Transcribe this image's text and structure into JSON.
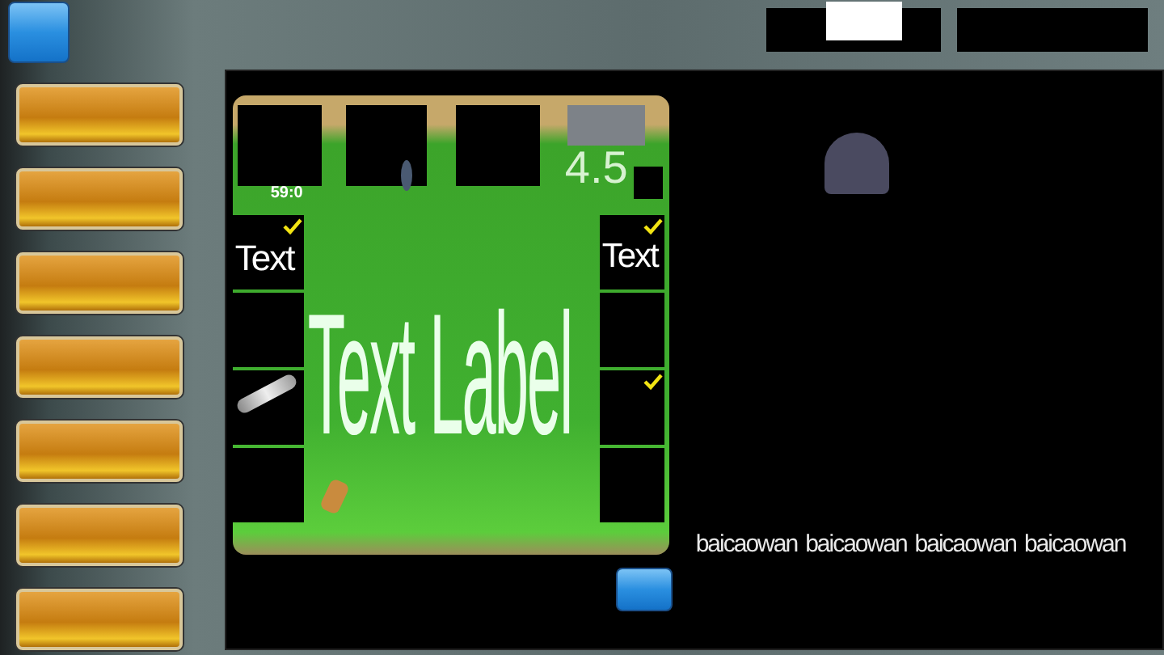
{
  "board": {
    "score": "59:0",
    "odds": "4.5",
    "label": "Text Label",
    "left_slots": [
      {
        "kind": "text",
        "text": "Text",
        "checked": true
      },
      {
        "kind": "empty",
        "checked": false
      },
      {
        "kind": "brush",
        "checked": false
      },
      {
        "kind": "empty",
        "checked": false
      }
    ],
    "right_slots": [
      {
        "kind": "text",
        "text": "Text",
        "checked": true
      },
      {
        "kind": "empty",
        "checked": false
      },
      {
        "kind": "empty",
        "checked": true
      },
      {
        "kind": "empty",
        "checked": false
      }
    ]
  },
  "names": [
    "baicaowan",
    "baicaowan",
    "baicaowan",
    "baicaowan"
  ]
}
